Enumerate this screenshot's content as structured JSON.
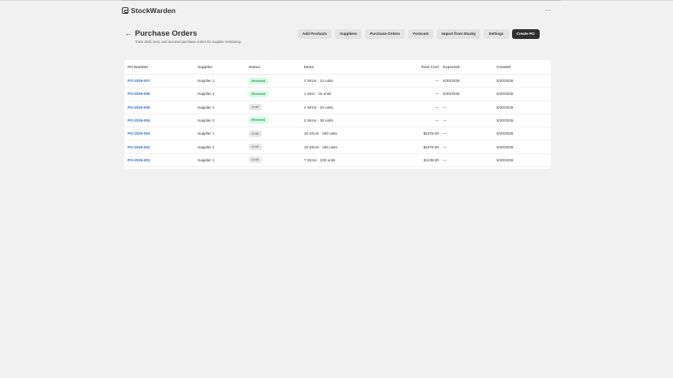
{
  "app": {
    "name": "StockWarden",
    "more_label": "···"
  },
  "page": {
    "back_label": "←",
    "title": "Purchase Orders",
    "subtitle": "Track draft, sent, and received purchase orders for supplier restocking."
  },
  "actions": [
    {
      "label": "Add Products",
      "primary": false
    },
    {
      "label": "Suppliers",
      "primary": false
    },
    {
      "label": "Purchase Orders",
      "primary": false
    },
    {
      "label": "Forecast",
      "primary": false
    },
    {
      "label": "Import from Stocky",
      "primary": false
    },
    {
      "label": "Settings",
      "primary": false
    },
    {
      "label": "Create PO",
      "primary": true
    }
  ],
  "table": {
    "headers": {
      "po_number": "PO Number",
      "supplier": "Supplier",
      "status": "Status",
      "items": "Items",
      "total_cost": "Total Cost",
      "expected": "Expected",
      "created": "Created"
    },
    "rows": [
      {
        "po": "PO-2026-007",
        "supplier": "Supplier 1",
        "status": "Received",
        "items": "2 SKUs · 21 units",
        "total": "—",
        "expected": "5/30/2026",
        "created": "5/20/2026"
      },
      {
        "po": "PO-2026-006",
        "supplier": "Supplier 1",
        "status": "Received",
        "items": "1 SKU · 16 units",
        "total": "—",
        "expected": "5/30/2026",
        "created": "5/20/2026"
      },
      {
        "po": "PO-2026-005",
        "supplier": "Supplier 2",
        "status": "Draft",
        "items": "2 SKUs · 20 units",
        "total": "—",
        "expected": "—",
        "created": "5/20/2026"
      },
      {
        "po": "PO-2026-004",
        "supplier": "Supplier 2",
        "status": "Received",
        "items": "2 SKUs · 38 units",
        "total": "—",
        "expected": "—",
        "created": "5/20/2026"
      },
      {
        "po": "PO-2026-003",
        "supplier": "Supplier 1",
        "status": "Draft",
        "items": "10 SKUs · 190 units",
        "total": "$1678.00",
        "expected": "—",
        "created": "5/20/2026"
      },
      {
        "po": "PO-2026-002",
        "supplier": "Supplier 1",
        "status": "Draft",
        "items": "10 SKUs · 190 units",
        "total": "$1678.00",
        "expected": "—",
        "created": "5/20/2026"
      },
      {
        "po": "PO-2026-001",
        "supplier": "Supplier 1",
        "status": "Draft",
        "items": "7 SKUs · 100 units",
        "total": "$1138.00",
        "expected": "—",
        "created": "5/20/2026"
      }
    ]
  },
  "colors": {
    "received_bg": "#cdfee1",
    "received_text": "#0c5132",
    "draft_bg": "#e8e8e8",
    "link": "#2c6ecb",
    "primary_button": "#303030"
  }
}
